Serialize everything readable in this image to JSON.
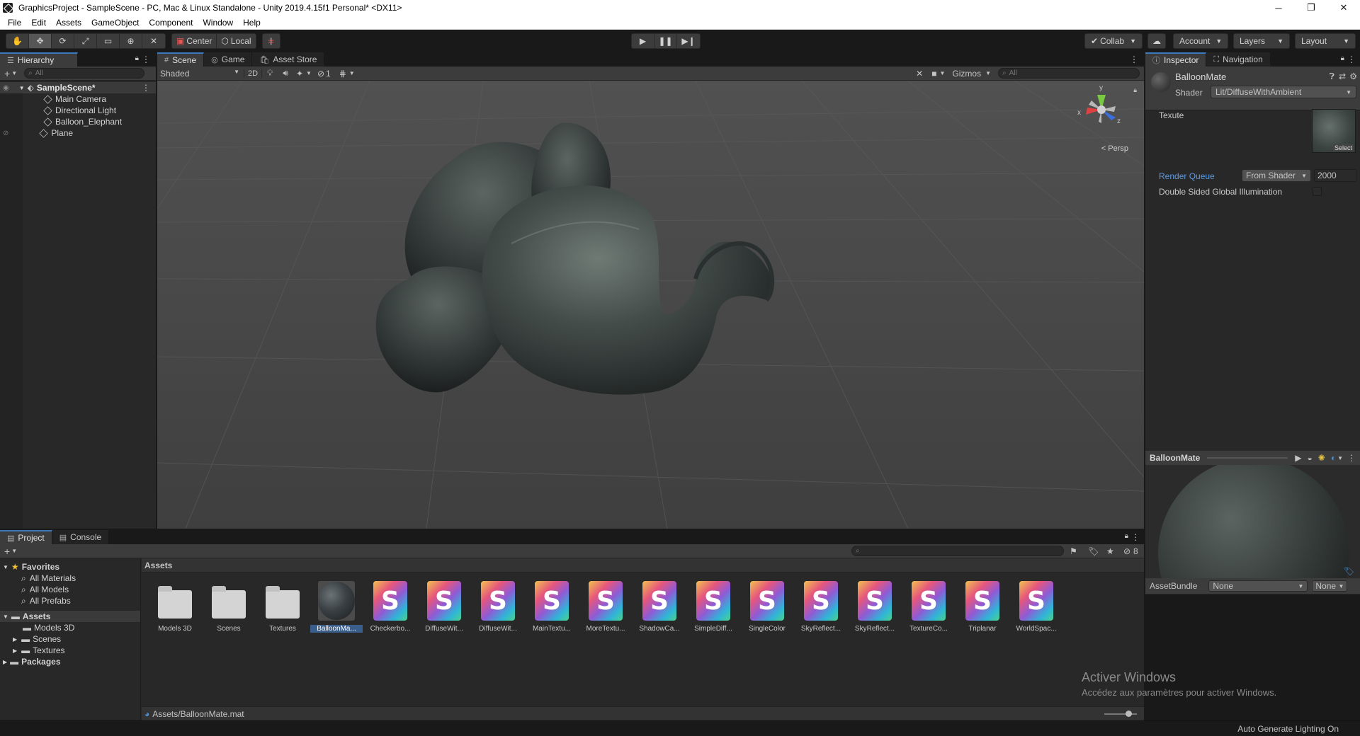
{
  "window": {
    "title": "GraphicsProject - SampleScene - PC, Mac & Linux Standalone - Unity 2019.4.15f1 Personal* <DX11>",
    "minimize": "─",
    "restore": "❐",
    "close": "✕"
  },
  "menu": [
    "File",
    "Edit",
    "Assets",
    "GameObject",
    "Component",
    "Window",
    "Help"
  ],
  "toolbar": {
    "pivot": "Center",
    "space": "Local",
    "collab": "Collab",
    "account": "Account",
    "layers": "Layers",
    "layout": "Layout"
  },
  "hierarchy": {
    "tab": "Hierarchy",
    "search_placeholder": "All",
    "scene": "SampleScene*",
    "items": [
      "Main Camera",
      "Directional Light",
      "Balloon_Elephant",
      "Plane"
    ]
  },
  "scene": {
    "tabs": [
      "Scene",
      "Game",
      "Asset Store"
    ],
    "shading": "Shaded",
    "mode_2d": "2D",
    "hidden_count": "1",
    "gizmos": "Gizmos",
    "search_placeholder": "All",
    "persp": "< Persp",
    "axis_x": "x",
    "axis_y": "y",
    "axis_z": "z"
  },
  "inspector": {
    "tabs": [
      "Inspector",
      "Navigation"
    ],
    "material_name": "BalloonMate",
    "shader_label": "Shader",
    "shader_value": "Lit/DiffuseWithAmbient",
    "texture_label": "Texute",
    "select_label": "Select",
    "render_queue_label": "Render Queue",
    "render_queue_mode": "From Shader",
    "render_queue_value": "2000",
    "double_sided_label": "Double Sided Global Illumination",
    "preview_title": "BalloonMate",
    "assetbundle_label": "AssetBundle",
    "assetbundle_value": "None",
    "assetbundle_variant": "None"
  },
  "project": {
    "tabs": [
      "Project",
      "Console"
    ],
    "favorites_label": "Favorites",
    "favorites": [
      "All Materials",
      "All Models",
      "All Prefabs"
    ],
    "assets_label": "Assets",
    "asset_folders": [
      "Models 3D",
      "Scenes",
      "Textures"
    ],
    "packages_label": "Packages",
    "breadcrumb": "Assets",
    "hidden_count": "8",
    "items": [
      {
        "label": "Models 3D",
        "kind": "folder"
      },
      {
        "label": "Scenes",
        "kind": "folder"
      },
      {
        "label": "Textures",
        "kind": "folder"
      },
      {
        "label": "BalloonMa...",
        "kind": "material"
      },
      {
        "label": "Checkerbo...",
        "kind": "shader"
      },
      {
        "label": "DiffuseWit...",
        "kind": "shader"
      },
      {
        "label": "DiffuseWit...",
        "kind": "shader"
      },
      {
        "label": "MainTextu...",
        "kind": "shader"
      },
      {
        "label": "MoreTextu...",
        "kind": "shader"
      },
      {
        "label": "ShadowCa...",
        "kind": "shader"
      },
      {
        "label": "SimpleDiff...",
        "kind": "shader"
      },
      {
        "label": "SingleColor",
        "kind": "shader"
      },
      {
        "label": "SkyReflect...",
        "kind": "shader"
      },
      {
        "label": "SkyReflect...",
        "kind": "shader"
      },
      {
        "label": "TextureCo...",
        "kind": "shader"
      },
      {
        "label": "Triplanar",
        "kind": "shader"
      },
      {
        "label": "WorldSpac...",
        "kind": "shader"
      }
    ],
    "shader_glyph": "S",
    "status_path": "Assets/BalloonMate.mat"
  },
  "watermark": {
    "line1": "Activer Windows",
    "line2": "Accédez aux paramètres pour activer Windows."
  },
  "statusbar": {
    "lighting": "Auto Generate Lighting On"
  },
  "colors": {
    "accent": "#3a79bb",
    "link_blue": "#5c9ae0",
    "panel": "#282828",
    "scene_bg": "#474747"
  }
}
